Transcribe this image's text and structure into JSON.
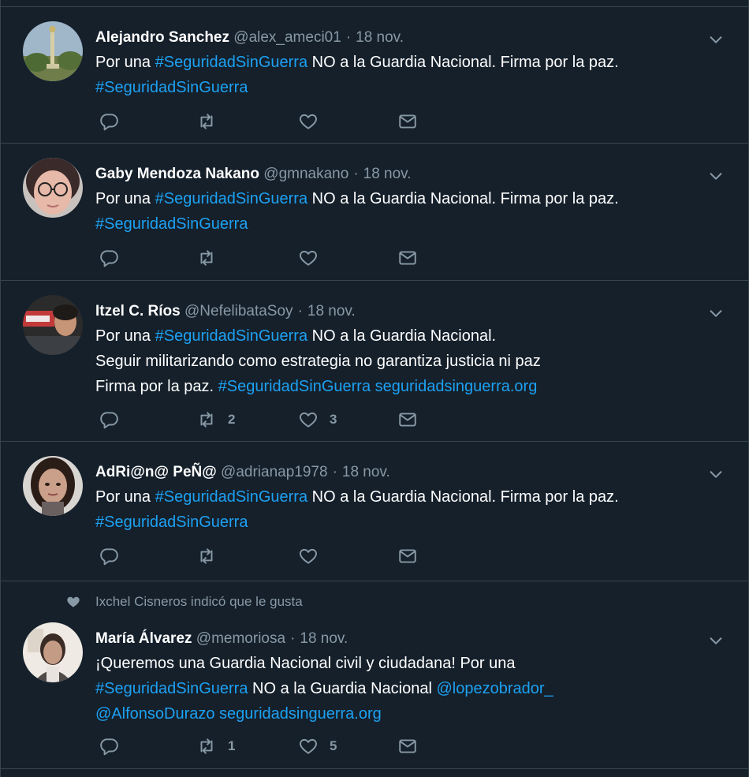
{
  "tweets": [
    {
      "name": "Alejandro Sanchez",
      "handle": "@alex_ameci01",
      "date": "18 nov.",
      "lines": [
        [
          {
            "t": "Por una "
          },
          {
            "t": "#SeguridadSinGuerra",
            "link": true
          },
          {
            "t": " NO a la Guardia Nacional. Firma por la paz."
          }
        ],
        [
          {
            "t": "#SeguridadSinGuerra",
            "link": true
          }
        ]
      ],
      "retweets": "",
      "likes": ""
    },
    {
      "name": "Gaby Mendoza Nakano",
      "handle": "@gmnakano",
      "date": "18 nov.",
      "lines": [
        [
          {
            "t": "Por una "
          },
          {
            "t": "#SeguridadSinGuerra",
            "link": true
          },
          {
            "t": " NO a la Guardia Nacional. Firma por la paz."
          }
        ],
        [
          {
            "t": "#SeguridadSinGuerra",
            "link": true
          }
        ]
      ],
      "retweets": "",
      "likes": ""
    },
    {
      "name": "Itzel C. Ríos",
      "handle": "@NefelibataSoy",
      "date": "18 nov.",
      "lines": [
        [
          {
            "t": "Por una "
          },
          {
            "t": "#SeguridadSinGuerra",
            "link": true
          },
          {
            "t": " NO a la Guardia Nacional."
          }
        ],
        [
          {
            "t": "Seguir militarizando como estrategia no garantiza justicia ni paz"
          }
        ],
        [
          {
            "t": "Firma por la paz. "
          },
          {
            "t": "#SeguridadSinGuerra",
            "link": true
          },
          {
            "t": " "
          },
          {
            "t": "seguridadsinguerra.org",
            "link": true
          }
        ]
      ],
      "retweets": "2",
      "likes": "3"
    },
    {
      "name": "AdRi@n@ PeÑ@",
      "handle": "@adrianap1978",
      "date": "18 nov.",
      "lines": [
        [
          {
            "t": "Por una "
          },
          {
            "t": "#SeguridadSinGuerra",
            "link": true
          },
          {
            "t": " NO a la Guardia Nacional. Firma por la paz."
          }
        ],
        [
          {
            "t": "#SeguridadSinGuerra",
            "link": true
          }
        ]
      ],
      "retweets": "",
      "likes": ""
    },
    {
      "social_context": "Ixchel Cisneros indicó que le gusta",
      "name": "María Álvarez",
      "handle": "@memoriosa",
      "date": "18 nov.",
      "lines": [
        [
          {
            "t": "¡Queremos una Guardia Nacional civil y ciudadana! Por una"
          }
        ],
        [
          {
            "t": "#SeguridadSinGuerra",
            "link": true
          },
          {
            "t": " NO a la Guardia Nacional "
          },
          {
            "t": "@lopezobrador_",
            "link": true
          }
        ],
        [
          {
            "t": "@AlfonsoDurazo",
            "link": true
          },
          {
            "t": " "
          },
          {
            "t": "seguridadsinguerra.org",
            "link": true
          }
        ]
      ],
      "retweets": "1",
      "likes": "5"
    }
  ],
  "icons": {
    "reply": "reply-icon",
    "retweet": "retweet-icon",
    "like": "heart-icon",
    "dm": "envelope-icon",
    "more": "chevron-down-icon"
  },
  "colors": {
    "background": "#15202b",
    "link": "#1da1f2",
    "muted": "#8899a6",
    "divider": "#38444d"
  }
}
